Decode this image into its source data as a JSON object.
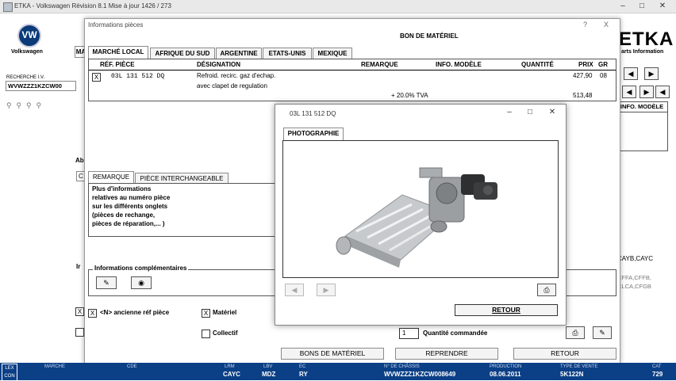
{
  "main_window": {
    "title": "ETKA - Volkswagen Révision 8.1 Mise à jour 1426 / 273",
    "brand": "Volkswagen",
    "etka_logo": "ETKA",
    "etka_sub": "arts Information",
    "search_label": "RECHERCHE I.V.",
    "search_value": "WVWZZZ1KZCW00",
    "info_modele_tab": "INFO. MODÈLE",
    "right_code": "CAYB,CAYC",
    "right_codes_2": "CFFA,CFFB,",
    "right_codes_3": "CLCA,CFGB",
    "left_tab_partial": "MA",
    "left_label_ab": "Ab",
    "left_label_c": "C",
    "left_label_ir": "Ir"
  },
  "statusbar": {
    "logo_top": "LEX",
    "logo_bottom": "CON",
    "fields": [
      {
        "label": "MARCHE",
        "value": ""
      },
      {
        "label": "CDE",
        "value": ""
      },
      {
        "label": "LRM",
        "value": "CAYC"
      },
      {
        "label": "LBV",
        "value": "MDZ"
      },
      {
        "label": "EC",
        "value": "RY"
      },
      {
        "label": "N° DE CHÂSSIS",
        "value": "WVWZZZ1KZCW008649"
      },
      {
        "label": "PRODUCTION",
        "value": "08.06.2011"
      },
      {
        "label": "TYPE DE VENTE",
        "value": "5K122N"
      },
      {
        "label": "CAT",
        "value": "729"
      }
    ]
  },
  "info_dialog": {
    "title": "Informations pièces",
    "help": "?",
    "close": "X",
    "section_title": "BON DE MATÉRIEL",
    "tabs": [
      "MARCHÉ LOCAL",
      "AFRIQUE DU SUD",
      "ARGENTINE",
      "ETATS-UNIS",
      "MEXIQUE"
    ],
    "columns": [
      "RÉF. PIÈCE",
      "DÉSIGNATION",
      "REMARQUE",
      "INFO. MODÈLE",
      "QUANTITÉ",
      "PRIX",
      "GR"
    ],
    "row": {
      "checked": "X",
      "ref": "03L 131 512 DQ",
      "designation_1": "Refroid. recirc. gaz d'echap.",
      "designation_2": "avec clapet de regulation",
      "price": "427,90",
      "gr": "08"
    },
    "tva_label": "+ 20.0% TVA",
    "tva_price": "513,48",
    "lower_tabs": [
      "REMARQUE",
      "PIÈCE INTERCHANGEABLE"
    ],
    "remark_lines": [
      "Plus d'informations",
      "relatives au numéro pièce",
      "sur les différents onglets",
      "(pièces de rechange,",
      "pièces de réparation,... )"
    ],
    "info_comp_label": "Informations complémentaires",
    "old_ref_check": "X",
    "old_ref_label": "<N> ancienne réf pièce",
    "materiel_check": "X",
    "materiel_label": "Matériel",
    "collectif_label": "Collectif",
    "quantity_value": "1",
    "quantity_label": "Quantité commandée",
    "btn_bons": "BONS DE MATÉRIEL",
    "btn_reprendre": "REPRENDRE",
    "btn_retour": "RETOUR"
  },
  "photo_dialog": {
    "title": "03L 131 512 DQ",
    "tab": "PHOTOGRAPHIE",
    "btn_retour": "RETOUR"
  }
}
